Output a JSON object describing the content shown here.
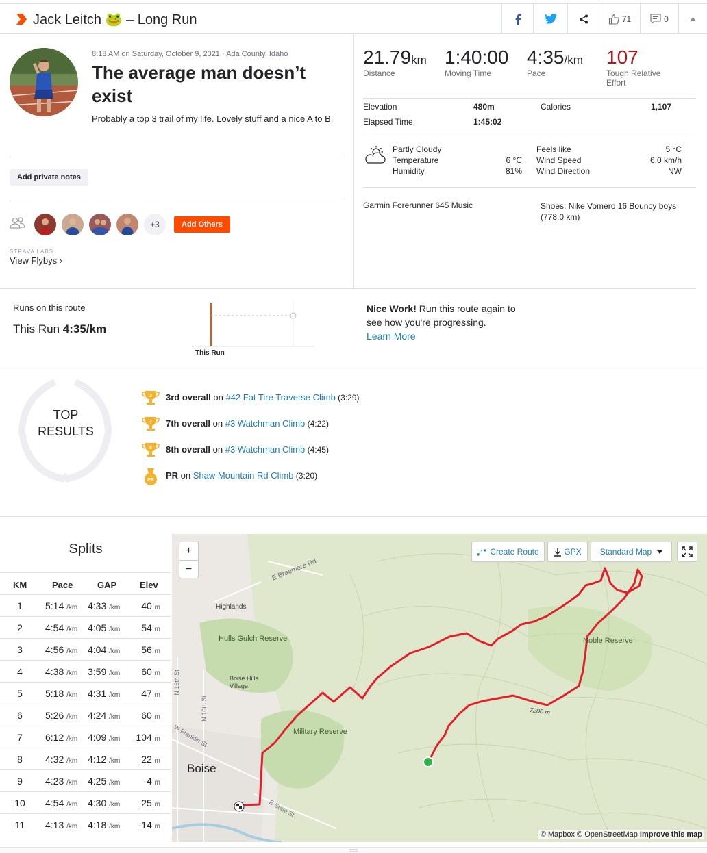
{
  "header": {
    "title": "Jack Leitch 🐸 – Long Run",
    "kudos_count": "71",
    "comment_count": "0"
  },
  "activity": {
    "datetime_location": "8:18 AM on Saturday, October 9, 2021 · Ada County, Idaho",
    "name": "The average man doesn’t exist",
    "description": "Probably a top 3 trail of my life. Lovely stuff and a nice A to B.",
    "private_notes_label": "Add private notes",
    "others_count": "+3",
    "add_others_label": "Add Others",
    "labs_label": "STRAVA LABS",
    "flybys_label": "View Flybys ›"
  },
  "stats": {
    "distance": {
      "value": "21.79",
      "unit": "km",
      "label": "Distance"
    },
    "moving_time": {
      "value": "1:40:00",
      "label": "Moving Time"
    },
    "pace": {
      "value": "4:35",
      "unit": "/km",
      "label": "Pace"
    },
    "effort": {
      "value": "107",
      "label": "Tough Relative Effort"
    },
    "elevation_label": "Elevation",
    "elevation_value": "480m",
    "elapsed_label": "Elapsed Time",
    "elapsed_value": "1:45:02",
    "calories_label": "Calories",
    "calories_value": "1,107"
  },
  "weather": {
    "condition": "Partly Cloudy",
    "temperature_label": "Temperature",
    "temperature_value": "6 °C",
    "humidity_label": "Humidity",
    "humidity_value": "81%",
    "feels_like_label": "Feels like",
    "feels_like_value": "5 °C",
    "wind_speed_label": "Wind Speed",
    "wind_speed_value": "6.0 km/h",
    "wind_direction_label": "Wind Direction",
    "wind_direction_value": "NW"
  },
  "gear": {
    "device": "Garmin Forerunner 645 Music",
    "shoes": "Shoes: Nike Vomero 16 Bouncy boys (778.0 km)"
  },
  "route_compare": {
    "label": "Runs on this route",
    "this_run_prefix": "This Run",
    "this_run_pace": "4:35/km",
    "chart_label": "This Run",
    "nice_bold": "Nice Work!",
    "nice_text": " Run this route again to see how you're progressing.",
    "learn_more": "Learn More"
  },
  "top_results": {
    "title_line1": "TOP",
    "title_line2": "RESULTS",
    "items": [
      {
        "rank": "3rd overall",
        "on": " on ",
        "segment": "#42 Fat Tire Traverse Climb",
        "time": " (3:29)",
        "medal": "3"
      },
      {
        "rank": "7th overall",
        "on": " on ",
        "segment": "#3 Watchman Climb",
        "time": " (4:22)",
        "medal": "7"
      },
      {
        "rank": "8th overall",
        "on": " on ",
        "segment": "#3 Watchman Climb",
        "time": " (4:45)",
        "medal": "8"
      },
      {
        "rank": "PR",
        "on": " on ",
        "segment": "Shaw Mountain Rd Climb",
        "time": " (3:20)",
        "medal": "PR"
      }
    ]
  },
  "splits": {
    "title": "Splits",
    "headers": [
      "KM",
      "Pace",
      "GAP",
      "Elev"
    ],
    "unit_pace": "/km",
    "unit_elev": "m",
    "rows": [
      {
        "km": "1",
        "pace": "5:14",
        "gap": "4:33",
        "elev": "40"
      },
      {
        "km": "2",
        "pace": "4:54",
        "gap": "4:05",
        "elev": "54"
      },
      {
        "km": "3",
        "pace": "4:56",
        "gap": "4:04",
        "elev": "56"
      },
      {
        "km": "4",
        "pace": "4:38",
        "gap": "3:59",
        "elev": "60"
      },
      {
        "km": "5",
        "pace": "5:18",
        "gap": "4:31",
        "elev": "47"
      },
      {
        "km": "6",
        "pace": "5:26",
        "gap": "4:24",
        "elev": "60"
      },
      {
        "km": "7",
        "pace": "6:12",
        "gap": "4:09",
        "elev": "104"
      },
      {
        "km": "8",
        "pace": "4:32",
        "gap": "4:12",
        "elev": "22"
      },
      {
        "km": "9",
        "pace": "4:23",
        "gap": "4:25",
        "elev": "-4"
      },
      {
        "km": "10",
        "pace": "4:54",
        "gap": "4:30",
        "elev": "25"
      },
      {
        "km": "11",
        "pace": "4:13",
        "gap": "4:18",
        "elev": "-14"
      }
    ]
  },
  "map": {
    "create_route": "Create Route",
    "gpx": "GPX",
    "map_style": "Standard Map",
    "attribution_1": "© Mapbox © OpenStreetMap ",
    "attribution_2": "Improve this map",
    "labels": [
      "E Braemere Rd",
      "Highlands",
      "Hulls Gulch Reserve",
      "Boise Hills Village",
      "N 16th St",
      "N 10th St",
      "W Franklin St",
      "Military Reserve",
      "Boise",
      "E State St",
      "Noble Reserve",
      "7200 m"
    ]
  },
  "colors": {
    "brand": "#fc4c02",
    "link": "#1e7eb8",
    "effort": "#b1161c",
    "route": "#e0202a"
  }
}
